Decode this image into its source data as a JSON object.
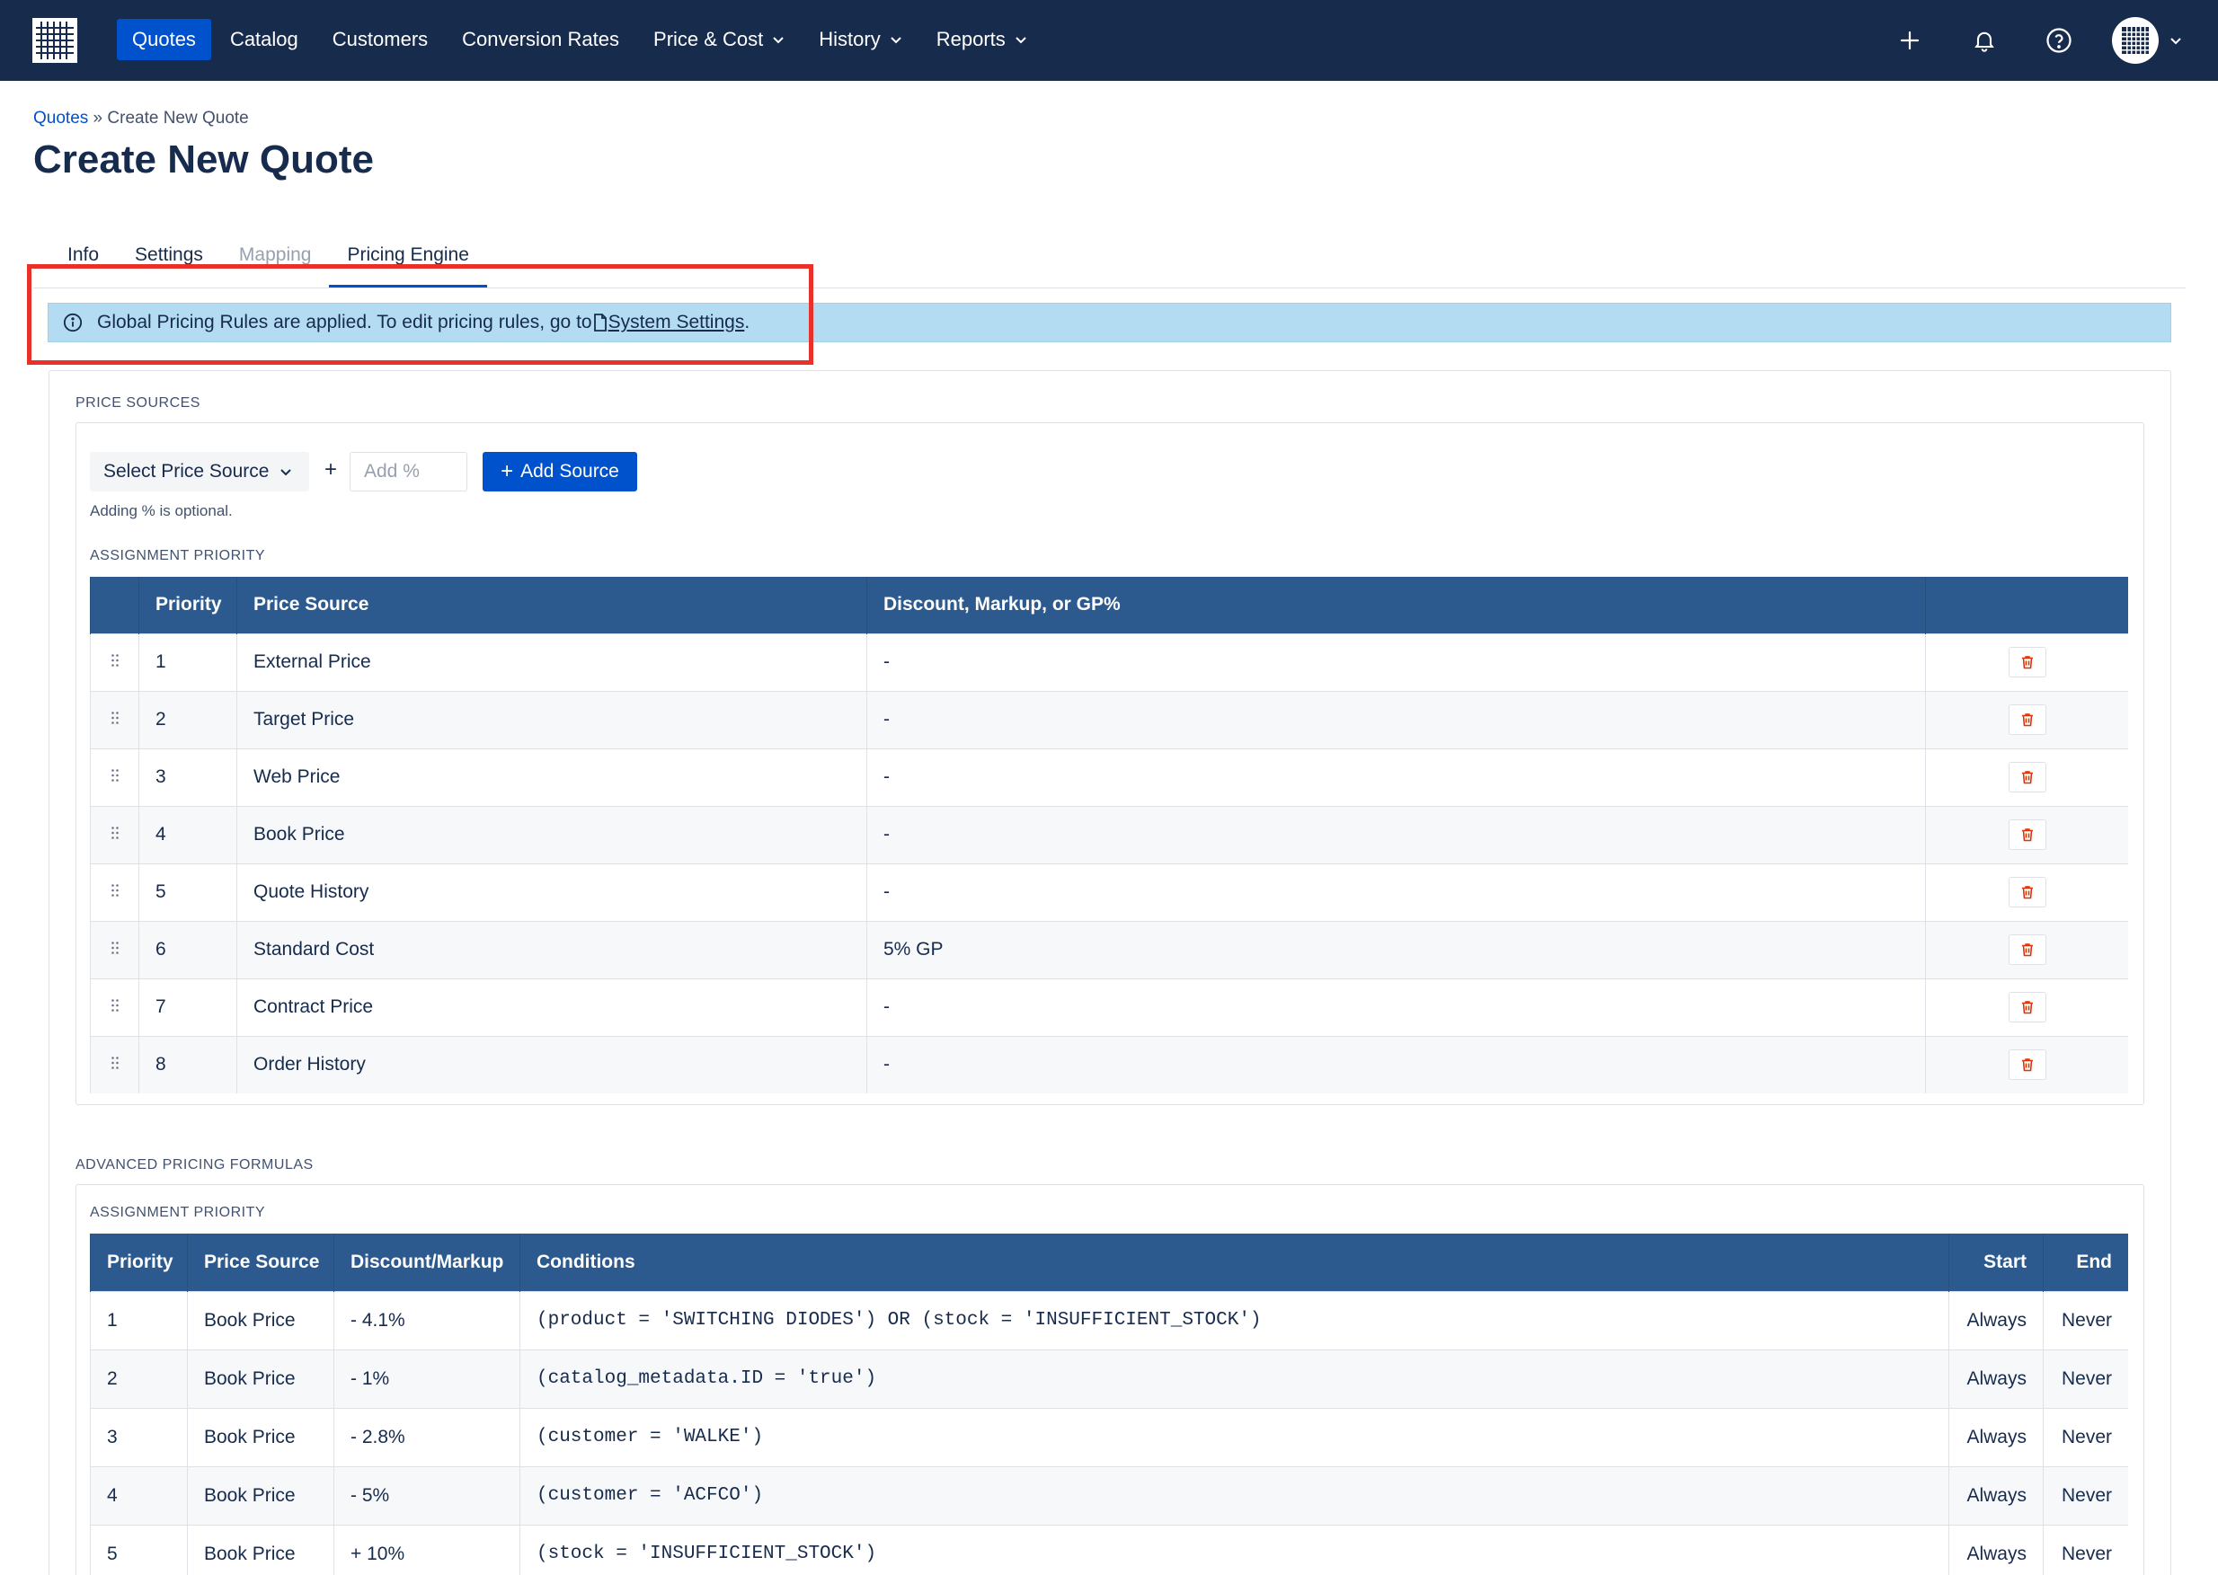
{
  "nav": {
    "items": [
      {
        "label": "Quotes",
        "active": true,
        "dropdown": false
      },
      {
        "label": "Catalog",
        "active": false,
        "dropdown": false
      },
      {
        "label": "Customers",
        "active": false,
        "dropdown": false
      },
      {
        "label": "Conversion Rates",
        "active": false,
        "dropdown": false
      },
      {
        "label": "Price & Cost",
        "active": false,
        "dropdown": true
      },
      {
        "label": "History",
        "active": false,
        "dropdown": true
      },
      {
        "label": "Reports",
        "active": false,
        "dropdown": true
      }
    ],
    "icons": [
      "plus-icon",
      "bell-icon",
      "help-icon",
      "avatar"
    ]
  },
  "breadcrumb": {
    "root": "Quotes",
    "separator": " » ",
    "current": "Create New Quote"
  },
  "page_title": "Create New Quote",
  "tabs": [
    {
      "label": "Info",
      "state": "normal"
    },
    {
      "label": "Settings",
      "state": "normal"
    },
    {
      "label": "Mapping",
      "state": "disabled"
    },
    {
      "label": "Pricing Engine",
      "state": "active"
    }
  ],
  "alert": {
    "text": "Global Pricing Rules are applied. To edit pricing rules, go to ",
    "link": " System Settings",
    "suffix": "."
  },
  "price_sources": {
    "section_label": "PRICE SOURCES",
    "select_label": "Select Price Source",
    "plus": "+",
    "percent_placeholder": "Add %",
    "add_button": "Add Source",
    "helper": "Adding % is optional.",
    "priority_label": "ASSIGNMENT PRIORITY",
    "columns": [
      "",
      "Priority",
      "Price Source",
      "Discount, Markup, or GP%",
      ""
    ],
    "rows": [
      {
        "priority": "1",
        "source": "External Price",
        "adjust": "-"
      },
      {
        "priority": "2",
        "source": "Target Price",
        "adjust": "-"
      },
      {
        "priority": "3",
        "source": "Web Price",
        "adjust": "-"
      },
      {
        "priority": "4",
        "source": "Book Price",
        "adjust": "-"
      },
      {
        "priority": "5",
        "source": "Quote History",
        "adjust": "-"
      },
      {
        "priority": "6",
        "source": "Standard Cost",
        "adjust": "5% GP"
      },
      {
        "priority": "7",
        "source": "Contract Price",
        "adjust": "-"
      },
      {
        "priority": "8",
        "source": "Order History",
        "adjust": "-"
      }
    ]
  },
  "advanced": {
    "section_label": "ADVANCED PRICING FORMULAS",
    "priority_label": "ASSIGNMENT PRIORITY",
    "columns": [
      "Priority",
      "Price Source",
      "Discount/Markup",
      "Conditions",
      "Start",
      "End"
    ],
    "rows": [
      {
        "priority": "1",
        "source": "Book Price",
        "adjust": "- 4.1%",
        "conditions": "(product = 'SWITCHING DIODES') OR (stock = 'INSUFFICIENT_STOCK')",
        "start": "Always",
        "end": "Never"
      },
      {
        "priority": "2",
        "source": "Book Price",
        "adjust": "- 1%",
        "conditions": "(catalog_metadata.ID = 'true')",
        "start": "Always",
        "end": "Never"
      },
      {
        "priority": "3",
        "source": "Book Price",
        "adjust": "- 2.8%",
        "conditions": "(customer = 'WALKE')",
        "start": "Always",
        "end": "Never"
      },
      {
        "priority": "4",
        "source": "Book Price",
        "adjust": "- 5%",
        "conditions": "(customer = 'ACFCO')",
        "start": "Always",
        "end": "Never"
      },
      {
        "priority": "5",
        "source": "Book Price",
        "adjust": "+ 10%",
        "conditions": "(stock = 'INSUFFICIENT_STOCK')",
        "start": "Always",
        "end": "Never"
      }
    ]
  },
  "colors": {
    "nav_bg": "#172b4d",
    "accent": "#0052cc",
    "table_header": "#2d5a8e",
    "alert_bg": "#b3dcf2",
    "highlight": "#e8312a",
    "delete": "#de350b"
  }
}
